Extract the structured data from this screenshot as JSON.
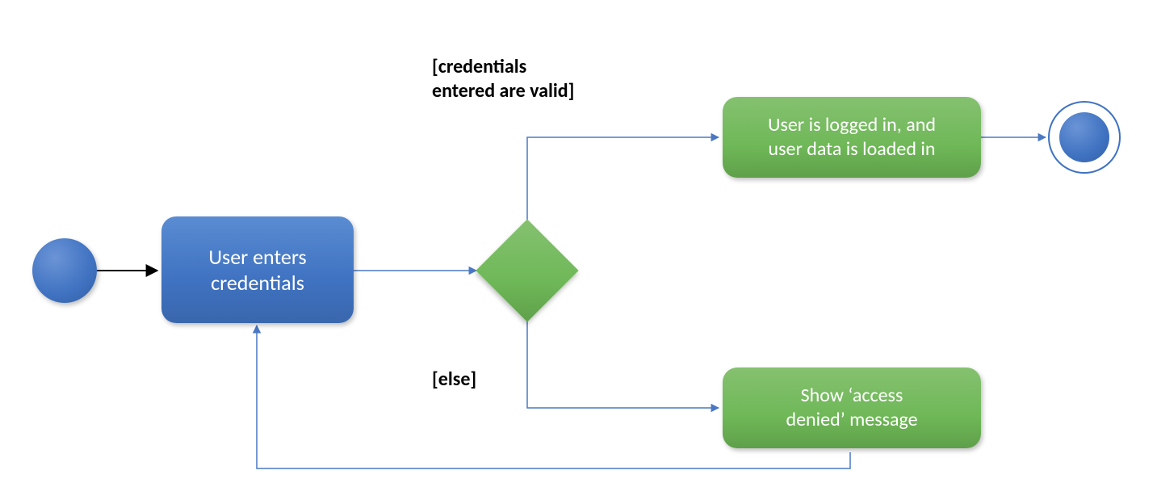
{
  "nodes": {
    "start": {
      "type": "initial"
    },
    "enter_credentials": {
      "label": "User enters\ncredentials"
    },
    "decision": {
      "type": "decision"
    },
    "logged_in": {
      "label": "User is logged in, and\nuser data is loaded in"
    },
    "access_denied": {
      "label": "Show ‘access\ndenied’ message"
    },
    "end": {
      "type": "final"
    }
  },
  "guards": {
    "valid": "[credentials\nentered are valid]",
    "else": "[else]"
  },
  "colors": {
    "blue": "#3f72c1",
    "green": "#6fb858",
    "edge_thin": "#4a78c4",
    "edge_black": "#000000"
  }
}
